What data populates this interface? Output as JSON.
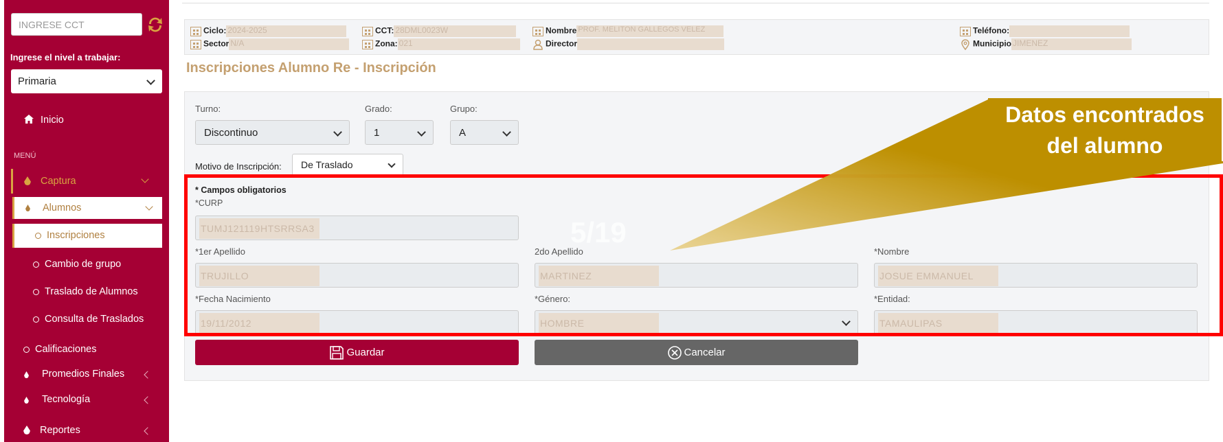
{
  "sidebar": {
    "cct_placeholder": "INGRESE CCT",
    "nivel_label": "Ingrese el nivel a trabajar:",
    "nivel_value": "Primaria",
    "inicio": "Inicio",
    "menu_label": "MENÚ",
    "captura": "Captura",
    "alumnos": "Alumnos",
    "inscripciones": "Inscripciones",
    "cambio_grupo": "Cambio de grupo",
    "traslado": "Traslado de Alumnos",
    "consulta_traslados": "Consulta de Traslados",
    "calificaciones": "Calificaciones",
    "promedios": "Promedios Finales",
    "tecnologia": "Tecnología",
    "reportes": "Reportes"
  },
  "info": {
    "ciclo_label": "Ciclo:",
    "ciclo_value": "2024-2025",
    "sector_label": "Sector",
    "sector_value": "N/A",
    "cct_label": "CCT:",
    "cct_value": "28DML0023W",
    "zona_label": "Zona:",
    "zona_value": "021",
    "nombre_label": "Nombre",
    "nombre_value": "PROF. MELITON GALLEGOS VELEZ",
    "director_label": "Director",
    "director_value": "",
    "telefono_label": "Teléfono:",
    "telefono_value": "",
    "municipio_label": "Municipio",
    "municipio_value": "JIMENEZ"
  },
  "page_title": "Inscripciones  Alumno Re - Inscripción",
  "form": {
    "turno_label": "Turno:",
    "turno_value": "Discontinuo",
    "grado_label": "Grado:",
    "grado_value": "1",
    "grupo_label": "Grupo:",
    "grupo_value": "A",
    "motivo_label": "Motivo de Inscripción:",
    "motivo_value": "De Traslado",
    "required_note": "* Campos obligatorios",
    "curp_label": "*CURP",
    "curp_value": "TUMJ121119HTSRRSA3",
    "apellido1_label": "*1er Apellido",
    "apellido1_value": "TRUJILLO",
    "apellido2_label": "2do Apellido",
    "apellido2_value": "MARTINEZ",
    "nombre_label": "*Nombre",
    "nombre_value": "JOSUE EMMANUEL",
    "fecha_label": "*Fecha Nacimiento",
    "fecha_value": "19/11/2012",
    "genero_label": "*Género:",
    "genero_value": "HOMBRE",
    "entidad_label": "*Entidad:",
    "entidad_value": "TAMAULIPAS",
    "guardar": "Guardar",
    "cancelar": "Cancelar"
  },
  "overlay": {
    "watermark": "5/19",
    "callout": "Datos encontrados del alumno"
  },
  "colors": {
    "brand": "#a50034",
    "gold": "#c4a070",
    "callout": "#bd8f00",
    "highlight": "#ff0000"
  }
}
